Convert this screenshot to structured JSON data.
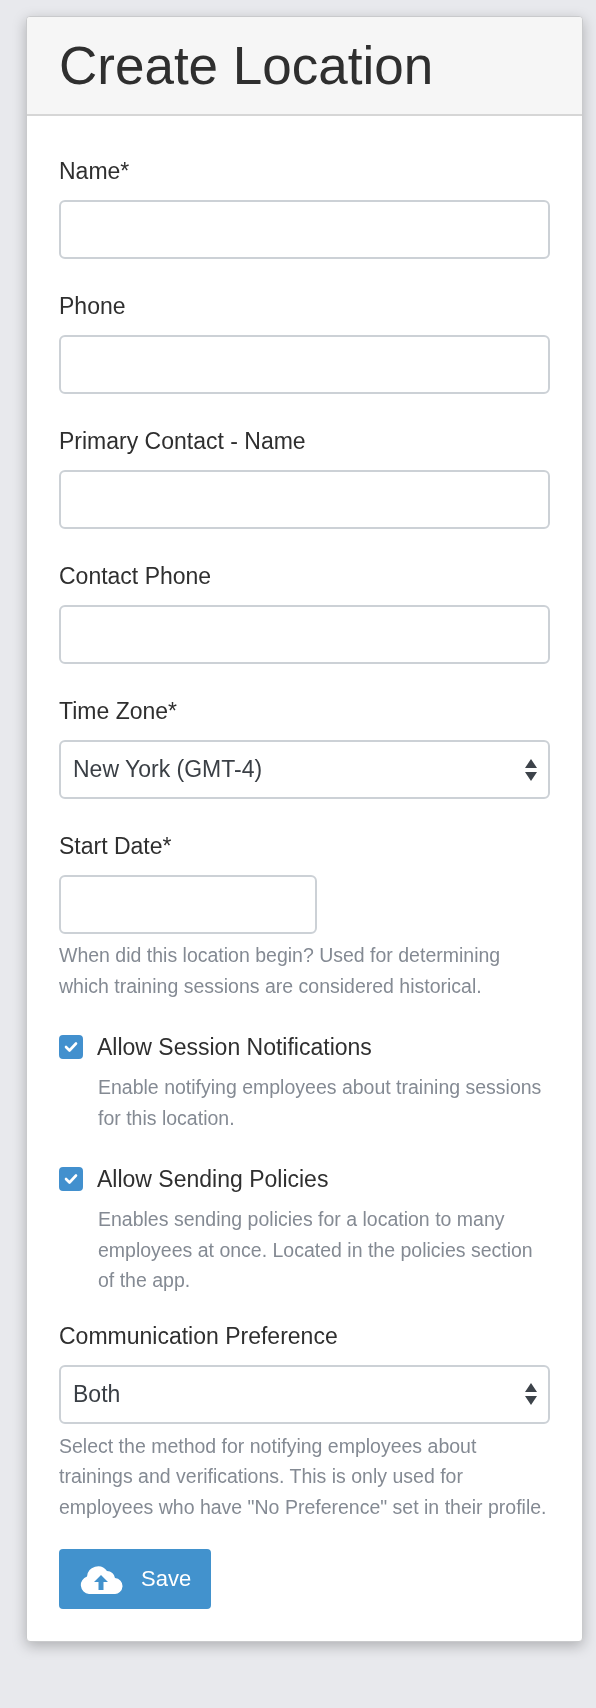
{
  "title": "Create Location",
  "fields": [
    {
      "kind": "text",
      "label": "Name*"
    },
    {
      "kind": "text",
      "label": "Phone"
    },
    {
      "kind": "text",
      "label": "Primary Contact - Name"
    },
    {
      "kind": "text",
      "label": "Contact Phone"
    },
    {
      "kind": "select",
      "label": "Time Zone*",
      "value": "New York (GMT-4)"
    },
    {
      "kind": "date",
      "label": "Start Date*",
      "help": "When did this location begin? Used for determining which training sessions are considered historical."
    },
    {
      "kind": "checkbox",
      "label": "Allow Session Notifications",
      "checked": true,
      "help": "Enable notifying employees about training sessions for this location."
    },
    {
      "kind": "checkbox",
      "label": "Allow Sending Policies",
      "checked": true,
      "help": "Enables sending policies for a location to many employees at once. Located in the policies section of the app."
    },
    {
      "kind": "select",
      "label": "Communication Preference",
      "value": "Both",
      "help": "Select the method for notifying employees about trainings and verifications. This is only used for employees who have \"No Preference\" set in their profile."
    }
  ],
  "save_button": {
    "label": "Save"
  }
}
